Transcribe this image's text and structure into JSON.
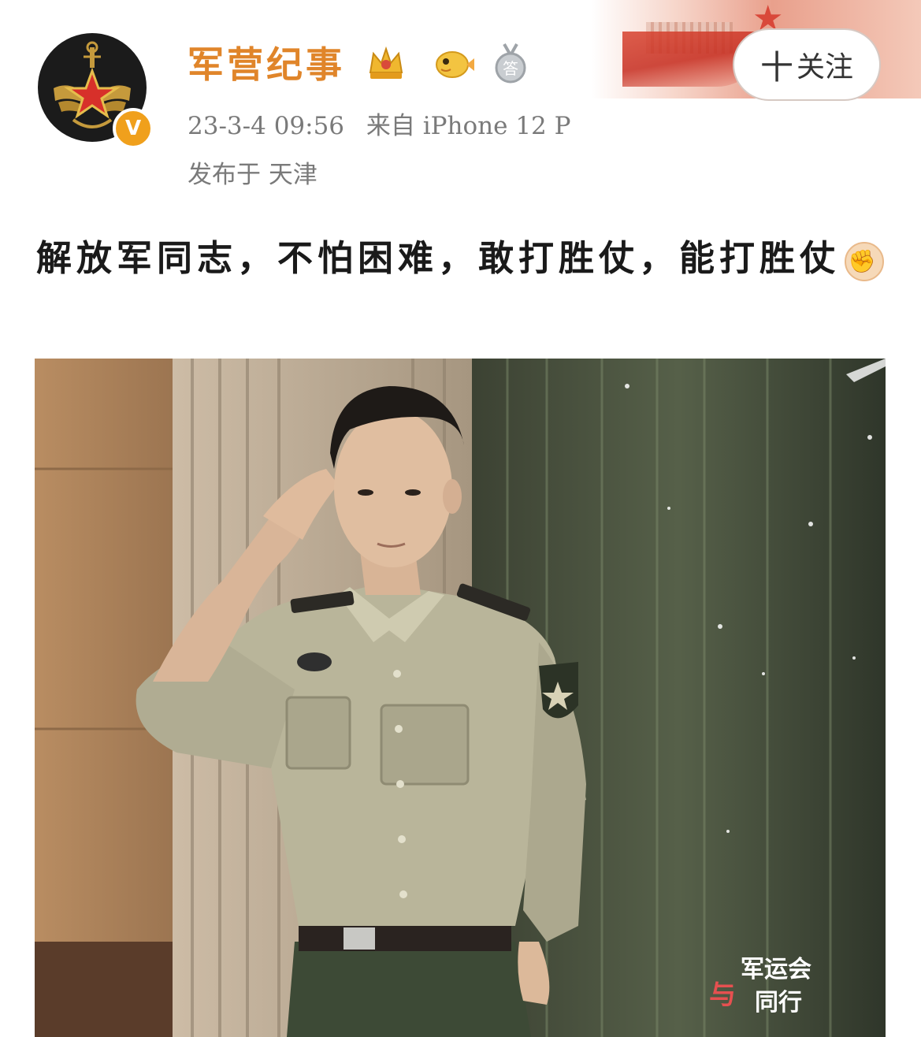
{
  "account": {
    "name": "军营纪事",
    "verified_badge": "V",
    "badge_icons": [
      "crown-badge-icon",
      "pufferfish-badge-icon",
      "answer-medal-icon"
    ],
    "answer_medal_label": "答"
  },
  "post": {
    "timestamp": "23-3-4 09:56",
    "source": "来自 iPhone 12 P",
    "location": "发布于 天津",
    "text": "解放军同志，不怕困难，敢打胜仗，能打胜仗",
    "emoji": "fist-emoji-icon"
  },
  "actions": {
    "follow_plus": "十",
    "follow_label": "关注"
  },
  "image": {
    "watermark_line1": "军运会",
    "watermark_line2": "与",
    "watermark_line3": "同行"
  },
  "colors": {
    "name": "#e0852a",
    "meta": "#7a7a7a",
    "text": "#1a1a1a",
    "verified": "#f0a01c"
  }
}
